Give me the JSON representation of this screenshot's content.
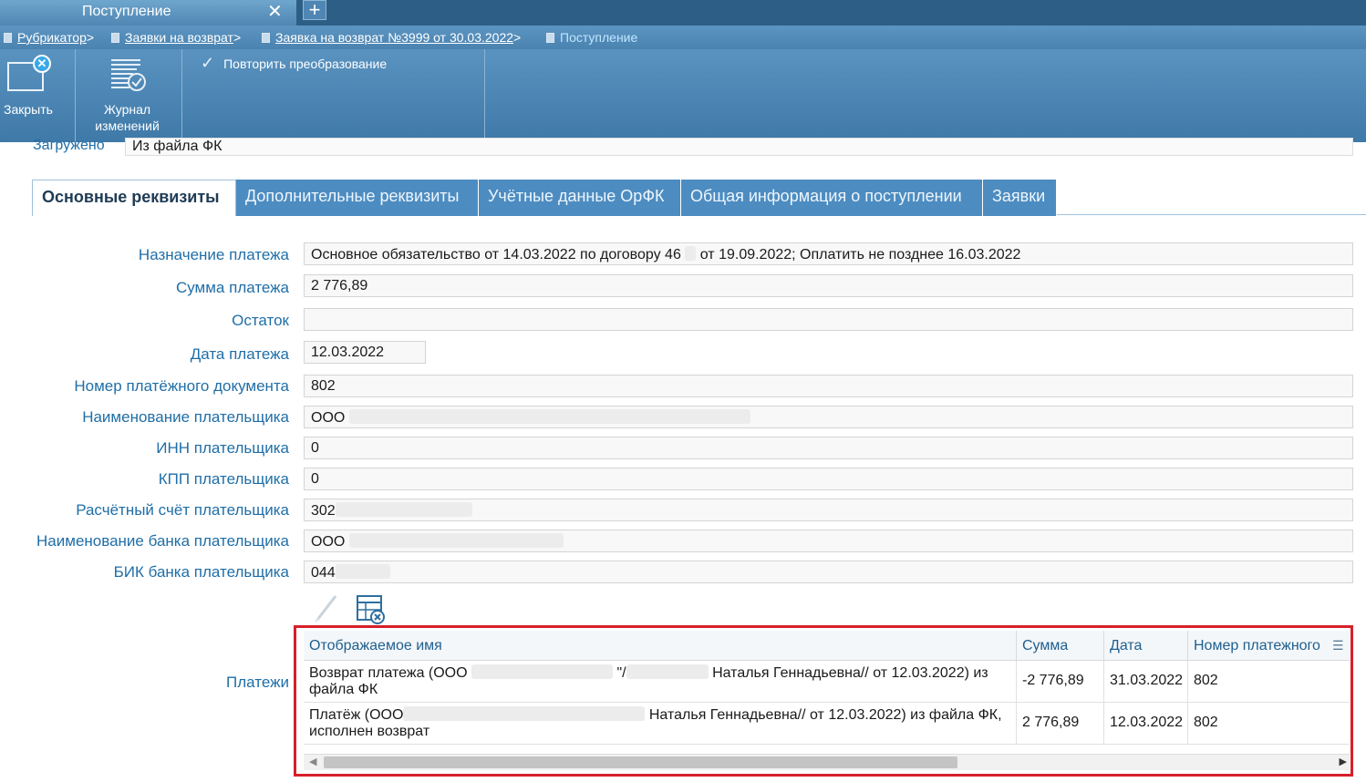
{
  "window": {
    "tab_title": "Поступление",
    "close_glyph": "✕",
    "add_glyph": "+"
  },
  "breadcrumb": {
    "items": [
      {
        "label": "Рубрикатор",
        "sep": ">"
      },
      {
        "label": "Заявки на возврат",
        "sep": ">"
      },
      {
        "label": "Заявка на возврат №3999 от 30.03.2022",
        "sep": ">"
      },
      {
        "label": "Поступление",
        "sep": ""
      }
    ]
  },
  "toolbar": {
    "close_label": "Закрыть",
    "journal_label_1": "Журнал",
    "journal_label_2": "изменений",
    "repeat_label": "Повторить преобразование"
  },
  "partial_row": {
    "label": "Загружено",
    "value": "Из файла ФК"
  },
  "tabs": [
    {
      "label": "Основные реквизиты",
      "selected": true
    },
    {
      "label": "Дополнительные реквизиты"
    },
    {
      "label": "Учётные данные ОрФК"
    },
    {
      "label": "Общая информация о поступлении"
    },
    {
      "label": "Заявки"
    }
  ],
  "form": {
    "purpose_label": "Назначение платежа",
    "purpose_a": "Основное обязательство от 14.03.2022 по договору 46",
    "purpose_b": "от 19.09.2022; Оплатить не позднее 16.03.2022",
    "amount_label": "Сумма платежа",
    "amount_value": "2 776,89",
    "rest_label": "Остаток",
    "rest_value": "",
    "date_label": "Дата платежа",
    "date_value": "12.03.2022",
    "docnum_label": "Номер платёжного документа",
    "docnum_value": "802",
    "payer_label": "Наименование плательщика",
    "payer_value": "ООО",
    "inn_label": "ИНН плательщика",
    "inn_value": "0",
    "kpp_label": "КПП плательщика",
    "kpp_value": "0",
    "account_label": "Расчётный счёт плательщика",
    "account_value": "302",
    "bank_label": "Наименование банка плательщика",
    "bank_value": "ООО",
    "bik_label": "БИК банка плательщика",
    "bik_value": "044",
    "payments_label": "Платежи"
  },
  "grid": {
    "columns": [
      "Отображаемое имя",
      "Сумма",
      "Дата",
      "Номер платежного"
    ],
    "rows": [
      {
        "name_a": "Возврат платежа (ООО",
        "name_b": "Наталья Геннадьевна// от 12.03.2022) из",
        "name_c": "файла ФК",
        "sum": "-2 776,89",
        "date": "31.03.2022",
        "num": "802"
      },
      {
        "name_a": "Платёж (ООО",
        "name_b": "Наталья Геннадьевна// от 12.03.2022) из файла ФК,",
        "name_c": "исполнен возврат",
        "sum": "2 776,89",
        "date": "12.03.2022",
        "num": "802"
      }
    ]
  },
  "colors": {
    "accent": "#4d8cc1",
    "label": "#1f6ea7",
    "highlight": "#d6202a"
  }
}
